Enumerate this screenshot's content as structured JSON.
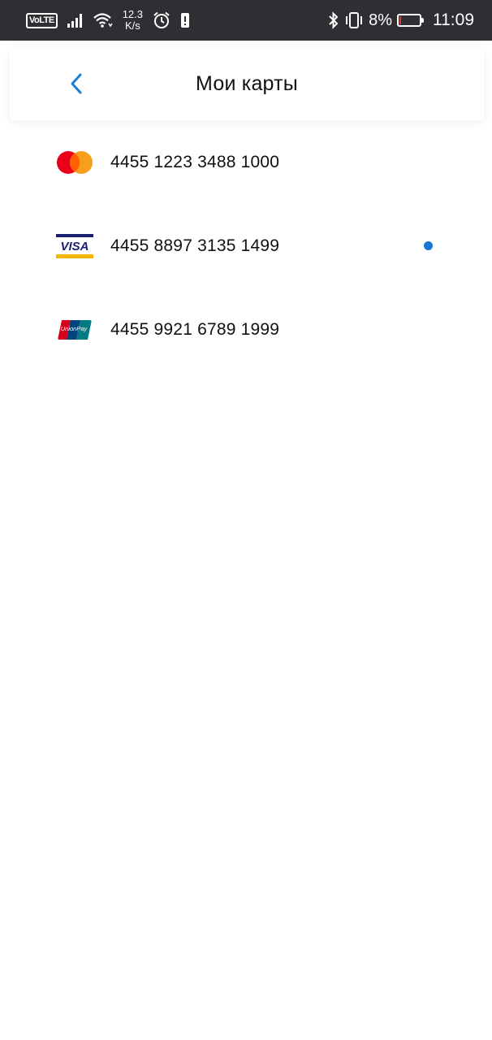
{
  "status_bar": {
    "volte": "VoLTE",
    "speed_value": "12.3",
    "speed_unit": "K/s",
    "battery_percent": "8%",
    "battery_level": 0.08,
    "time": "11:09",
    "icons": [
      "signal-icon",
      "wifi-icon",
      "alarm-icon",
      "sim-icon",
      "bluetooth-icon",
      "vibrate-icon",
      "battery-icon"
    ]
  },
  "header": {
    "title": "Мои карты",
    "back_icon": "chevron-left-icon",
    "accent_color": "#1a7fd6"
  },
  "cards": [
    {
      "brand": "mastercard",
      "number": "4455 1223 3488 1000",
      "selected": false
    },
    {
      "brand": "visa",
      "number": "4455 8897 3135 1499",
      "selected": true
    },
    {
      "brand": "unionpay",
      "number": "4455 9921 6789 1999",
      "selected": false
    }
  ],
  "logos": {
    "visa_text": "VISA",
    "unionpay_text": "UnionPay"
  },
  "colors": {
    "status_bar_bg": "#2f2f33",
    "selected_dot": "#1976d2"
  }
}
